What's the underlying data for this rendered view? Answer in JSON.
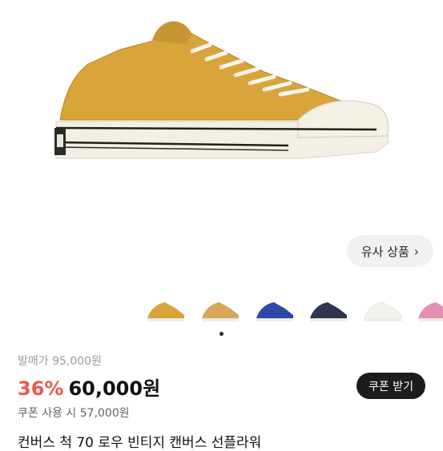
{
  "similar_button": {
    "label": "유사 상품",
    "icon": "chevron-right-icon"
  },
  "thumbnails": [
    {
      "color": "#d9a43a"
    },
    {
      "color": "#d6a85a"
    },
    {
      "color": "#2a4aa8"
    },
    {
      "color": "#2f3550"
    },
    {
      "color": "#f4f2ee"
    },
    {
      "color": "#e58fb5"
    }
  ],
  "pricing": {
    "original_price": "발매가 95,000원",
    "discount": "36%",
    "sale_price": "60,000원",
    "coupon_price": "쿠폰 사용 시 57,000원",
    "coupon_button": "쿠폰 받기",
    "accent_color": "#ea5a4e"
  },
  "product": {
    "name": "컨버스 척 70 로우 빈티지 캔버스 선플라워"
  }
}
